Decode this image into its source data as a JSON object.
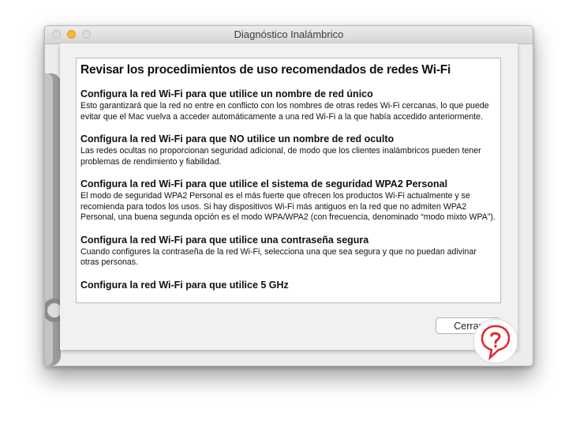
{
  "window": {
    "title": "Diagnóstico Inalámbrico"
  },
  "content": {
    "heading": "Revisar los procedimientos de uso recomendados de redes Wi-Fi",
    "sections": [
      {
        "title": "Configura la red Wi-Fi para que utilice un nombre de red único",
        "body": "Esto garantizará que la red no entre en conflicto con los nombres de otras redes Wi-Fi cercanas, lo que puede evitar que el Mac vuelva a acceder automáticamente a una red Wi-Fi a la que había accedido anteriormente."
      },
      {
        "title": "Configura la red Wi-Fi para que NO utilice un nombre de red oculto",
        "body": "Las redes ocultas no proporcionan seguridad adicional, de modo que los clientes inalámbricos pueden tener problemas de rendimiento y fiabilidad."
      },
      {
        "title": "Configura la red Wi-Fi para que utilice el sistema de seguridad WPA2 Personal",
        "body": "El modo de seguridad WPA2 Personal es el más fuerte que ofrecen los productos Wi-Fi actualmente y se recomienda para todos los usos. Si hay dispositivos Wi-Fi más antiguos en la red que no admiten WPA2 Personal, una buena segunda opción es el modo WPA/WPA2 (con frecuencia, denominado “modo mixto WPA”)."
      },
      {
        "title": "Configura la red Wi-Fi para que utilice una contraseña segura",
        "body": "Cuando configures la contraseña de la red Wi-Fi, selecciona una que sea segura y que no puedan adivinar otras personas."
      },
      {
        "title": "Configura la red Wi-Fi para que utilice 5 GHz",
        "body": ""
      }
    ]
  },
  "buttons": {
    "close_label": "Cerrar"
  },
  "icons": {
    "window_controls": [
      "close-light",
      "minimize-light",
      "zoom-light"
    ],
    "background": "wrench-icon",
    "watermark": "solvetic-logo-icon"
  },
  "colors": {
    "minimize_light": "#f5b83a",
    "watermark_red": "#e2262b"
  }
}
